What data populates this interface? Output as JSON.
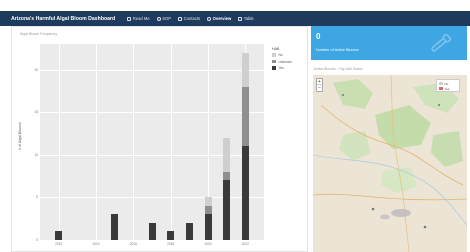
{
  "app": {
    "title": "Arizona's Harmful Algal Bloom Dashboard",
    "nav": [
      {
        "label": "Read Me",
        "icon": "book-icon"
      },
      {
        "label": "SOP",
        "icon": "github-icon"
      },
      {
        "label": "Contacts",
        "icon": "contacts-icon"
      },
      {
        "label": "Overview",
        "icon": "dashboard-icon",
        "active": true
      },
      {
        "label": "Table",
        "icon": "table-icon"
      }
    ],
    "colors": {
      "header": "#1e3a5c",
      "card": "#3ea6e3",
      "no": "#cfcfcf",
      "unknown": "#8f8f8f",
      "yes": "#3a3a3a"
    }
  },
  "chart_panel": {
    "title": "Algal Bloom Frequency"
  },
  "chart_data": {
    "type": "bar",
    "stacked": true,
    "ylabel": "# of Algal Blooms",
    "legend_title": "HAB",
    "legend_position": "right",
    "yticks": [
      "0",
      "5",
      "10",
      "15",
      "20"
    ],
    "ylim": [
      0,
      23
    ],
    "xticks": [
      "2012",
      "2014",
      "2016",
      "2018",
      "2020",
      "2022"
    ],
    "x": [
      2012,
      2015,
      2017,
      2018,
      2019,
      2020,
      2021,
      2022
    ],
    "series": [
      {
        "name": "Yes",
        "values": [
          1,
          3,
          2,
          1,
          2,
          3,
          7,
          11
        ]
      },
      {
        "name": "Unknown",
        "values": [
          0,
          0,
          0,
          0,
          0,
          1,
          1,
          7
        ]
      },
      {
        "name": "No",
        "values": [
          0,
          0,
          0,
          0,
          0,
          1,
          4,
          4
        ]
      }
    ]
  },
  "card": {
    "value": "0",
    "label": "Number of Active Blooms"
  },
  "map_panel": {
    "title": "Active Blooms - City Nat'l Status",
    "zoom_in": "+",
    "zoom_out": "−",
    "legend": [
      {
        "label": "No"
      },
      {
        "label": "Yes"
      }
    ]
  }
}
